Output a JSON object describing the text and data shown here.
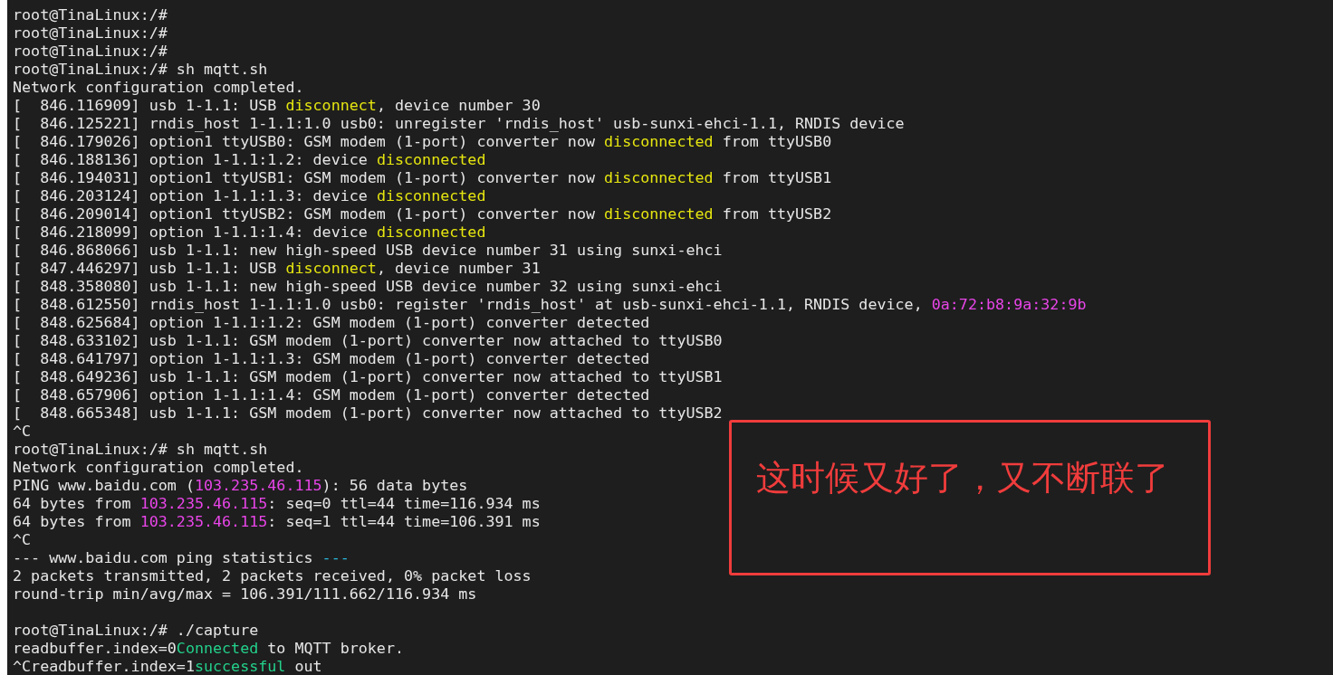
{
  "terminal": {
    "lines": [
      {
        "kind": "text",
        "segments": [
          {
            "text": "root@TinaLinux:/#"
          }
        ]
      },
      {
        "kind": "text",
        "segments": [
          {
            "text": "root@TinaLinux:/#"
          }
        ]
      },
      {
        "kind": "text",
        "segments": [
          {
            "text": "root@TinaLinux:/#"
          }
        ]
      },
      {
        "kind": "text",
        "segments": [
          {
            "text": "root@TinaLinux:/# sh mqtt.sh"
          }
        ]
      },
      {
        "kind": "text",
        "segments": [
          {
            "text": "Network configuration completed."
          }
        ]
      },
      {
        "kind": "text",
        "segments": [
          {
            "text": "[  846.116909] usb 1-1.1: USB "
          },
          {
            "text": "disconnect",
            "color": "#e5e510"
          },
          {
            "text": ", device number 30"
          }
        ]
      },
      {
        "kind": "text",
        "segments": [
          {
            "text": "[  846.125221] rndis_host 1-1.1:1.0 usb0: unregister 'rndis_host' usb-sunxi-ehci-1.1, RNDIS device"
          }
        ]
      },
      {
        "kind": "text",
        "segments": [
          {
            "text": "[  846.179026] option1 ttyUSB0: GSM modem (1-port) converter now "
          },
          {
            "text": "disconnected",
            "color": "#e5e510"
          },
          {
            "text": " from ttyUSB0"
          }
        ]
      },
      {
        "kind": "text",
        "segments": [
          {
            "text": "[  846.188136] option 1-1.1:1.2: device "
          },
          {
            "text": "disconnected",
            "color": "#e5e510"
          }
        ]
      },
      {
        "kind": "text",
        "segments": [
          {
            "text": "[  846.194031] option1 ttyUSB1: GSM modem (1-port) converter now "
          },
          {
            "text": "disconnected",
            "color": "#e5e510"
          },
          {
            "text": " from ttyUSB1"
          }
        ]
      },
      {
        "kind": "text",
        "segments": [
          {
            "text": "[  846.203124] option 1-1.1:1.3: device "
          },
          {
            "text": "disconnected",
            "color": "#e5e510"
          }
        ]
      },
      {
        "kind": "text",
        "segments": [
          {
            "text": "[  846.209014] option1 ttyUSB2: GSM modem (1-port) converter now "
          },
          {
            "text": "disconnected",
            "color": "#e5e510"
          },
          {
            "text": " from ttyUSB2"
          }
        ]
      },
      {
        "kind": "text",
        "segments": [
          {
            "text": "[  846.218099] option 1-1.1:1.4: device "
          },
          {
            "text": "disconnected",
            "color": "#e5e510"
          }
        ]
      },
      {
        "kind": "text",
        "segments": [
          {
            "text": "[  846.868066] usb 1-1.1: new high-speed USB device number 31 using sunxi-ehci"
          }
        ]
      },
      {
        "kind": "text",
        "segments": [
          {
            "text": "[  847.446297] usb 1-1.1: USB "
          },
          {
            "text": "disconnect",
            "color": "#e5e510"
          },
          {
            "text": ", device number 31"
          }
        ]
      },
      {
        "kind": "text",
        "segments": [
          {
            "text": "[  848.358080] usb 1-1.1: new high-speed USB device number 32 using sunxi-ehci"
          }
        ]
      },
      {
        "kind": "text",
        "segments": [
          {
            "text": "[  848.612550] rndis_host 1-1.1:1.0 usb0: register 'rndis_host' at usb-sunxi-ehci-1.1, RNDIS device, "
          },
          {
            "text": "0a:72:b8:9a:32:9b",
            "color": "#e845e8"
          }
        ]
      },
      {
        "kind": "text",
        "segments": [
          {
            "text": "[  848.625684] option 1-1.1:1.2: GSM modem (1-port) converter detected"
          }
        ]
      },
      {
        "kind": "text",
        "segments": [
          {
            "text": "[  848.633102] usb 1-1.1: GSM modem (1-port) converter now attached to ttyUSB0"
          }
        ]
      },
      {
        "kind": "text",
        "segments": [
          {
            "text": "[  848.641797] option 1-1.1:1.3: GSM modem (1-port) converter detected"
          }
        ]
      },
      {
        "kind": "text",
        "segments": [
          {
            "text": "[  848.649236] usb 1-1.1: GSM modem (1-port) converter now attached to ttyUSB1"
          }
        ]
      },
      {
        "kind": "text",
        "segments": [
          {
            "text": "[  848.657906] option 1-1.1:1.4: GSM modem (1-port) converter detected"
          }
        ]
      },
      {
        "kind": "text",
        "segments": [
          {
            "text": "[  848.665348] usb 1-1.1: GSM modem (1-port) converter now attached to ttyUSB2"
          }
        ]
      },
      {
        "kind": "text",
        "segments": [
          {
            "text": "^C"
          }
        ]
      },
      {
        "kind": "text",
        "segments": [
          {
            "text": "root@TinaLinux:/# sh mqtt.sh"
          }
        ]
      },
      {
        "kind": "text",
        "segments": [
          {
            "text": "Network configuration completed."
          }
        ]
      },
      {
        "kind": "text",
        "segments": [
          {
            "text": "PING www.baidu.com ("
          },
          {
            "text": "103.235.46.115",
            "color": "#e845e8"
          },
          {
            "text": "): 56 data bytes"
          }
        ]
      },
      {
        "kind": "text",
        "segments": [
          {
            "text": "64 bytes from "
          },
          {
            "text": "103.235.46.115",
            "color": "#e845e8"
          },
          {
            "text": ": seq=0 ttl=44 time=116.934 ms"
          }
        ]
      },
      {
        "kind": "text",
        "segments": [
          {
            "text": "64 bytes from "
          },
          {
            "text": "103.235.46.115",
            "color": "#e845e8"
          },
          {
            "text": ": seq=1 ttl=44 time=106.391 ms"
          }
        ]
      },
      {
        "kind": "text",
        "segments": [
          {
            "text": "^C"
          }
        ]
      },
      {
        "kind": "text",
        "segments": [
          {
            "text": "--- www.baidu.com ping statistics "
          },
          {
            "text": "---",
            "color": "#29b8db"
          }
        ]
      },
      {
        "kind": "text",
        "segments": [
          {
            "text": "2 packets transmitted, 2 packets received, 0% packet loss"
          }
        ]
      },
      {
        "kind": "text",
        "segments": [
          {
            "text": "round-trip min/avg/max = 106.391/111.662/116.934 ms"
          }
        ]
      },
      {
        "kind": "blank"
      },
      {
        "kind": "text",
        "segments": [
          {
            "text": "root@TinaLinux:/# ./capture"
          }
        ]
      },
      {
        "kind": "text",
        "segments": [
          {
            "text": "readbuffer.index=0"
          },
          {
            "text": "Connected",
            "color": "#23d18b"
          },
          {
            "text": " to MQTT broker."
          }
        ]
      },
      {
        "kind": "text",
        "segments": [
          {
            "text": "^Creadbuffer.index=1"
          },
          {
            "text": "successful",
            "color": "#23d18b"
          },
          {
            "text": " out"
          }
        ]
      }
    ]
  },
  "annotation": {
    "text": "这时候又好了，又不断联了"
  }
}
